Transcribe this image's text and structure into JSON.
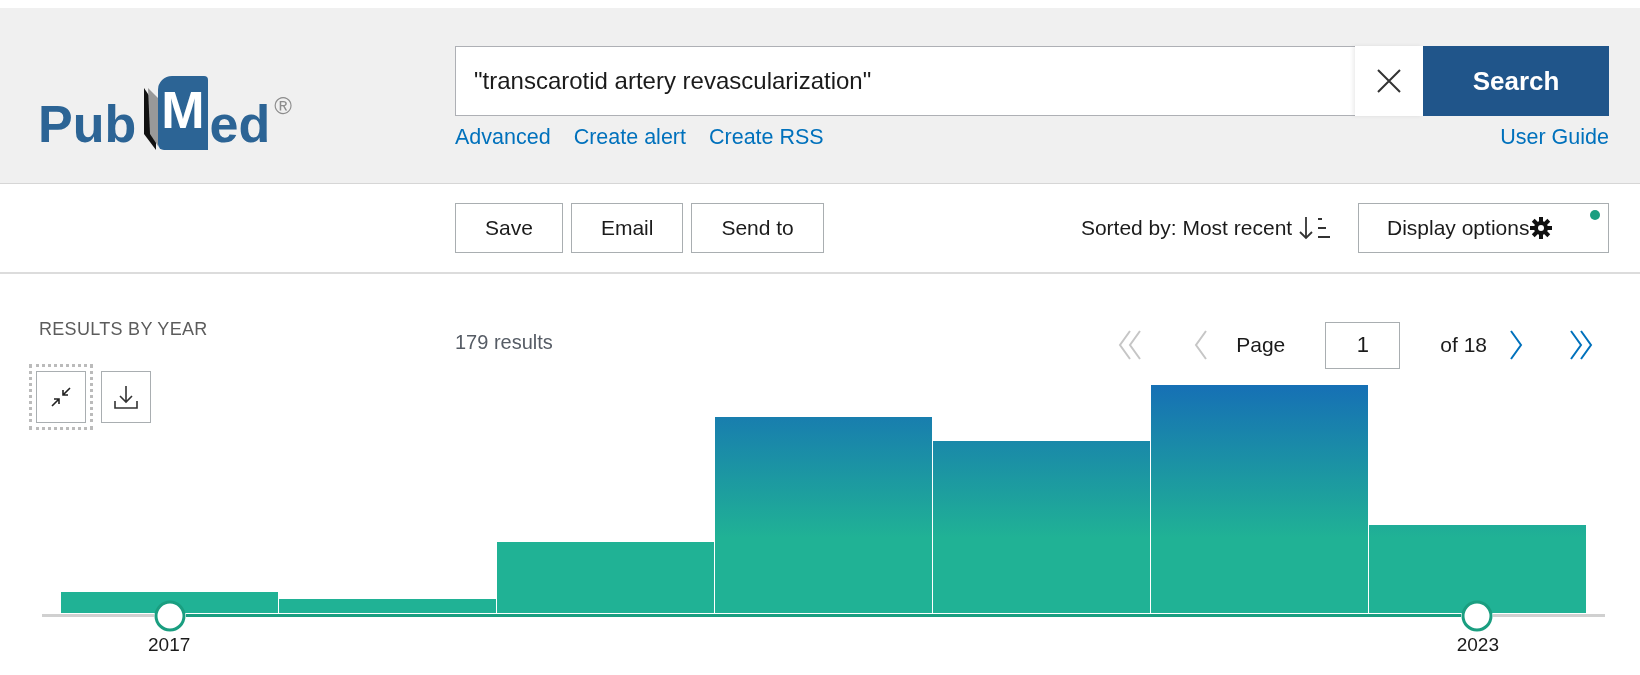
{
  "logo": {
    "first": "Pub",
    "initial": "M",
    "rest": "ed",
    "mark": "®"
  },
  "search": {
    "value": "\"transcarotid artery revascularization\"",
    "button": "Search"
  },
  "search_links": [
    "Advanced",
    "Create alert",
    "Create RSS"
  ],
  "user_guide": "User Guide",
  "actions": [
    "Save",
    "Email",
    "Send to"
  ],
  "sort": {
    "label": "Sorted by: Most recent"
  },
  "display_options": {
    "label": "Display options",
    "modified": true
  },
  "timeline": {
    "title": "RESULTS BY YEAR",
    "start_label": "2017",
    "end_label": "2023"
  },
  "results_count": "179 results",
  "pagination": {
    "first_disabled": true,
    "prev_disabled": true,
    "page_label": "Page",
    "page": "1",
    "of": "of 18",
    "next_disabled": false,
    "last_disabled": false
  }
}
